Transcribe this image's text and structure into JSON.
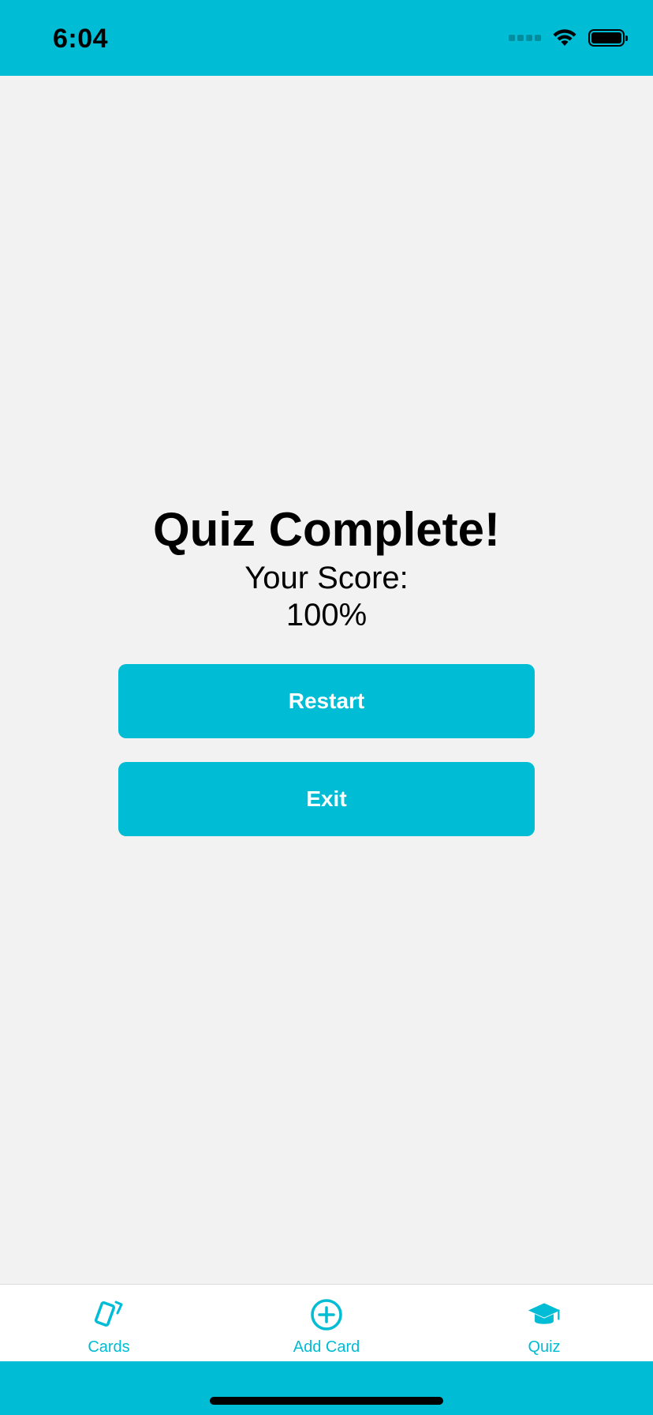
{
  "status_bar": {
    "time": "6:04"
  },
  "main": {
    "title": "Quiz Complete!",
    "score_label": "Your Score:",
    "score_value": "100%",
    "restart_label": "Restart",
    "exit_label": "Exit"
  },
  "tab_bar": {
    "items": [
      {
        "label": "Cards",
        "icon": "cards-icon"
      },
      {
        "label": "Add Card",
        "icon": "add-circle-icon"
      },
      {
        "label": "Quiz",
        "icon": "graduation-cap-icon"
      }
    ]
  },
  "colors": {
    "accent": "#00bcd4",
    "background": "#f2f2f2"
  }
}
